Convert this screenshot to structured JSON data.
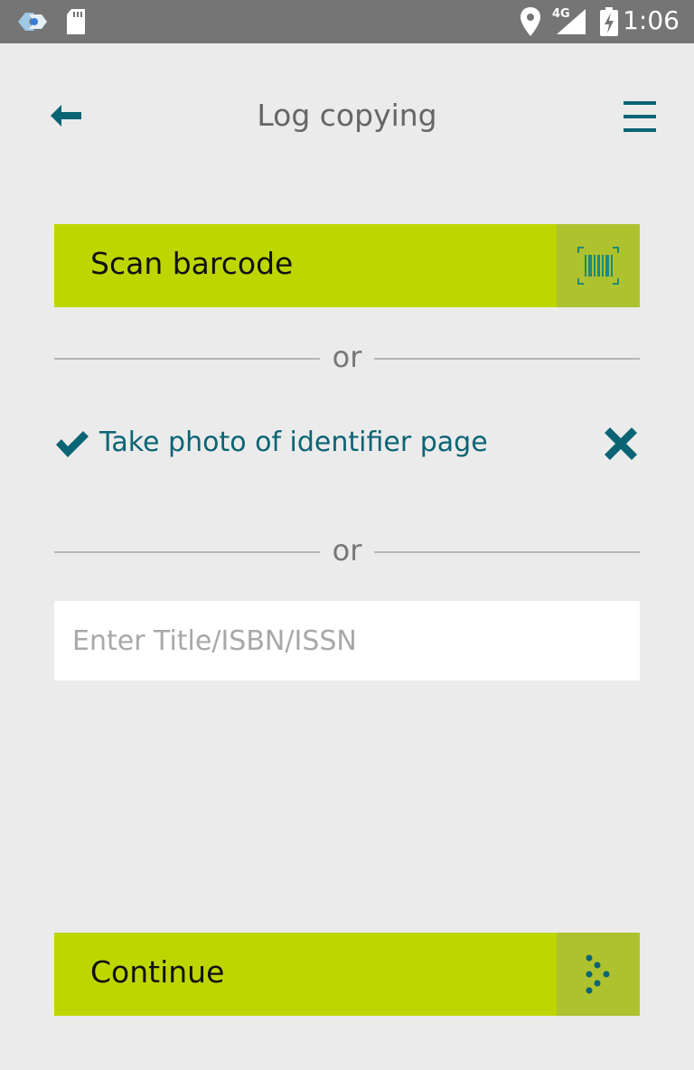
{
  "status_bar": {
    "network": "4G",
    "time": "1:06",
    "icons": [
      "app-notification-icon",
      "sd-card-icon",
      "location-icon",
      "signal-icon",
      "battery-charging-icon"
    ]
  },
  "header": {
    "title": "Log copying",
    "back_icon": "back-arrow-icon",
    "menu_icon": "hamburger-menu-icon"
  },
  "scan": {
    "label": "Scan barcode",
    "icon": "barcode-icon"
  },
  "separator_text": "or",
  "photo": {
    "label": "Take photo of identifier page",
    "status_icon": "checkmark-icon",
    "remove_icon": "close-icon"
  },
  "search": {
    "placeholder": "Enter Title/ISBN/ISSN",
    "value": ""
  },
  "continue": {
    "label": "Continue",
    "icon": "dotted-arrow-icon"
  },
  "colors": {
    "accent": "#bed600",
    "accent_dark": "#adc22e",
    "teal": "#0b6474",
    "background": "#ebebeb"
  }
}
